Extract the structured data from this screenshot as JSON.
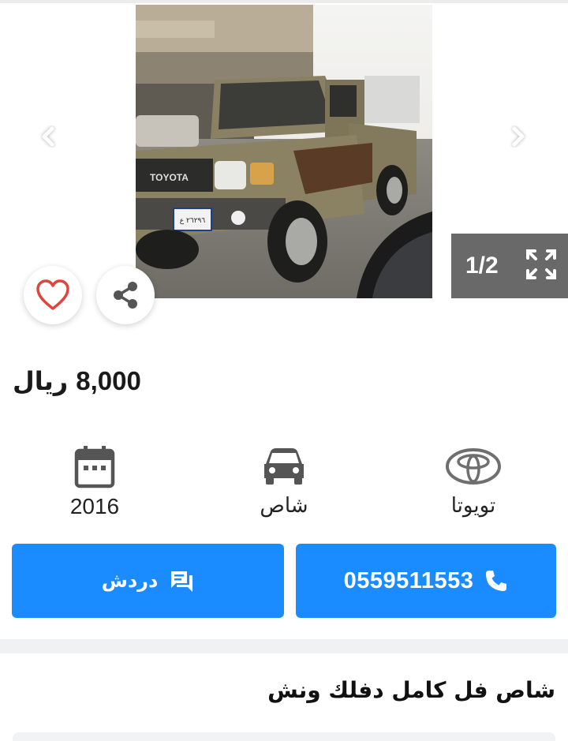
{
  "gallery": {
    "counter": "1/2",
    "photo_plate": "٢٦٢٩٦ ع",
    "photo_brand": "TOYOTA"
  },
  "listing": {
    "price": "8,000",
    "currency": "ريال",
    "title": "شاص فل كامل دفلك ونش"
  },
  "specs": {
    "year": "2016",
    "type": "شاص",
    "make": "تويوتا"
  },
  "actions": {
    "chat_label": "دردش",
    "phone_number": "0559511553"
  },
  "colors": {
    "accent": "#1a8cff",
    "favorite": "#e0443e",
    "icon_gray": "#555555",
    "counter_bg": "#696969"
  }
}
